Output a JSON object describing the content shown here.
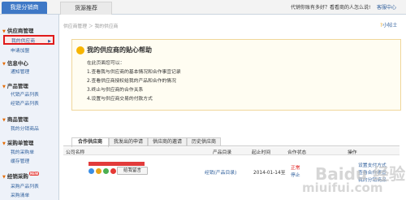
{
  "topbar": {
    "tab_active": "我是分销商",
    "tab_other": "货源推荐",
    "right_text": "代销你账有多好？看看商的人怎么说!",
    "right_link": "客服中心"
  },
  "sidebar": {
    "sections": [
      {
        "title": "供应商管理",
        "items": [
          "我的供应商",
          "申请加盟"
        ]
      },
      {
        "title": "信息中心",
        "items": [
          "通知管理"
        ]
      },
      {
        "title": "产品管理",
        "items": [
          "代销产品列表",
          "经销产品列表"
        ]
      },
      {
        "title": "商品管理",
        "items": [
          "我的分销商品"
        ]
      },
      {
        "title": "采购单管理",
        "items": [
          "我的采购单",
          "缓存管理"
        ]
      },
      {
        "title": "经销采购",
        "badge": "NEW",
        "items": [
          "采购产品列表",
          "采购清单"
        ]
      }
    ]
  },
  "breadcrumb": "供应商管理 ＞ 我的供应商",
  "helper": "小帖士",
  "info": {
    "title": "我的供应商的贴心帮助",
    "lines": [
      "在此页面您可以：",
      "1.查看我与供应商的基本情况和合作事宜记录",
      "2.查看供应商授权给我的产品和合作的情况",
      "3.终止与供应商的合作关系",
      "4.设置与供应商交易的付款方式"
    ]
  },
  "tabs": [
    "合作供应商",
    "我发出的申请",
    "供应商的邀请",
    "历史供应商"
  ],
  "table": {
    "headers": [
      "公司名称",
      "产品目录",
      "起止时间",
      "合作状态",
      "操作"
    ],
    "row": {
      "chat_label": "给我留言",
      "catalog": "经销(产品目录)",
      "date": "2014-01-14至",
      "status_main": "正常",
      "status_action": "停止",
      "ops": [
        "设置支付方式",
        "查看合作事宜",
        "我的分销商品"
      ]
    }
  },
  "watermark": {
    "line1": "Baidu 经验",
    "line2": "miuifui.com"
  },
  "colors": {
    "accent": "#3e78c6",
    "highlight_border": "#e01a1a",
    "link": "#2f5f9c"
  }
}
